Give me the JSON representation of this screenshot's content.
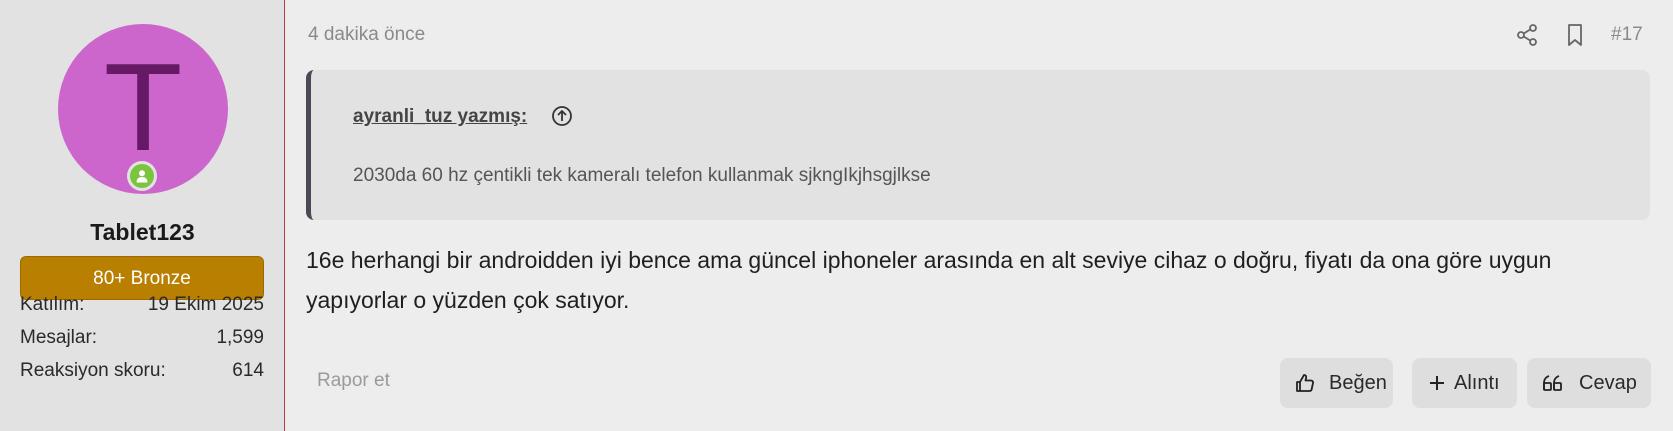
{
  "user": {
    "avatar_letter": "T",
    "avatar_color": "#cc66cc",
    "online_icon": "user-online-icon",
    "name": "Tablet123",
    "title": "80+ Bronze",
    "title_color": "#b87f00",
    "stats": [
      {
        "label": "Katılım:",
        "value": "19 Ekim 2025"
      },
      {
        "label": "Mesajlar:",
        "value": "1,599"
      },
      {
        "label": "Reaksiyon skoru:",
        "value": "614"
      }
    ]
  },
  "post": {
    "time": "4 dakika önce",
    "number": "#17",
    "header_icons": [
      "share-icon",
      "bookmark-icon"
    ],
    "quote": {
      "author": "ayranli_tuz yazmış:",
      "jump_icon": "arrow-up-circle-icon",
      "text": "2030da 60 hz çentikli tek kameralı telefon kullanmak sjkngIkjhsgjlkse"
    },
    "message": "16e herhangi bir androidden iyi bence ama güncel iphoneler arasında en alt seviye cihaz o doğru, fiyatı da ona göre uygun yapıyorlar o yüzden çok satıyor.",
    "report": "Rapor et",
    "actions": {
      "like": {
        "label": "Beğen",
        "icon": "thumbs-up-icon"
      },
      "quote": {
        "label": "Alıntı",
        "icon": "plus-icon"
      },
      "reply": {
        "label": "Cevap",
        "icon": "quote-marks-icon"
      }
    }
  },
  "colors": {
    "accent_border": "#b8413e",
    "online": "#7cc440"
  }
}
